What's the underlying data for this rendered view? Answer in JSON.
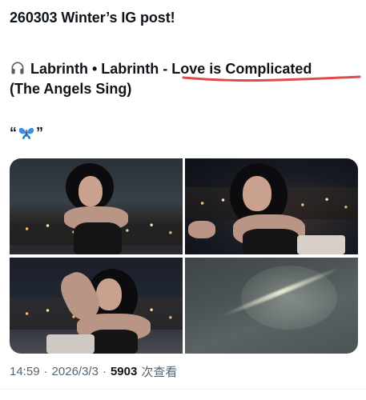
{
  "post": {
    "title": "260303 Winter’s IG post!",
    "song": {
      "icon": "headphones-icon",
      "artist_line": "Labrinth • Labrinth - ",
      "highlight": "Love is Complicated",
      "subtitle": "(The Angels Sing)"
    },
    "quote": {
      "open": "“",
      "icon": "butterfly-icon",
      "close": "”"
    },
    "media": [
      {
        "name": "photo-1"
      },
      {
        "name": "photo-2"
      },
      {
        "name": "photo-3"
      },
      {
        "name": "photo-4"
      }
    ],
    "meta": {
      "time": "14:59",
      "sep1": "·",
      "date": "2026/3/3",
      "sep2": "·",
      "views_count": "5903",
      "views_label": "次查看"
    }
  },
  "colors": {
    "text": "#0f1419",
    "muted": "#536471",
    "underline": "#e04a4a",
    "butterfly": "#3b8fe0"
  }
}
